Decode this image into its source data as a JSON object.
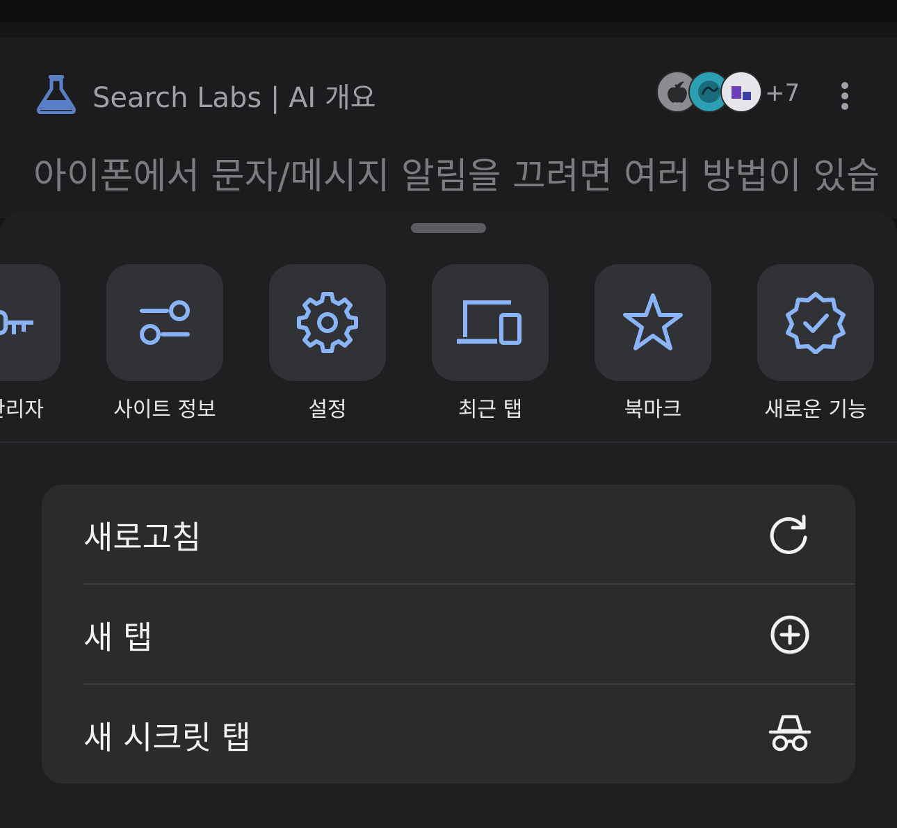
{
  "background_page": {
    "title": "Search Labs | AI 개요",
    "avatar_more": "+7",
    "body_text": "아이폰에서 문자/메시지 알림을 끄려면 여러 방법이 있습"
  },
  "tiles": [
    {
      "label": "호 관리자",
      "icon": "key-icon"
    },
    {
      "label": "사이트 정보",
      "icon": "site-info-toggles-icon"
    },
    {
      "label": "설정",
      "icon": "gear-icon"
    },
    {
      "label": "최근 탭",
      "icon": "devices-icon"
    },
    {
      "label": "북마크",
      "icon": "star-icon"
    },
    {
      "label": "새로운 기능",
      "icon": "verified-badge-icon"
    }
  ],
  "menu": [
    {
      "label": "새로고침",
      "icon": "refresh-icon"
    },
    {
      "label": "새 탭",
      "icon": "plus-circle-icon"
    },
    {
      "label": "새 시크릿 탭",
      "icon": "incognito-icon"
    }
  ],
  "colors": {
    "accent_blue": "#8ab4f8",
    "sheet_bg": "#1f1f21",
    "card_bg": "#2b2b2e",
    "tile_bg": "#303236",
    "labs_icon": "#5a7fc6"
  }
}
